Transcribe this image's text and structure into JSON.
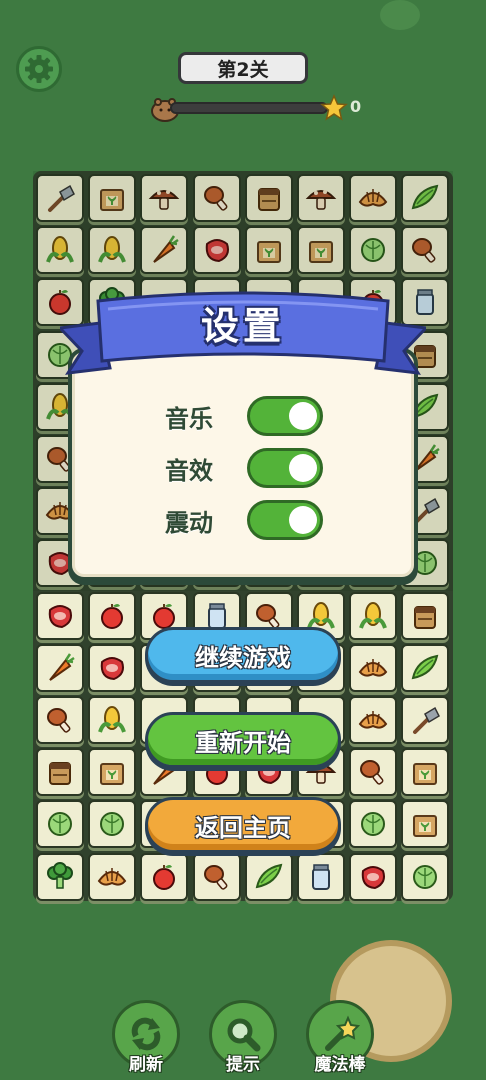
{
  "header": {
    "level_label": "第2关",
    "star_count": "0",
    "progress_fraction": 0.0
  },
  "settings_dialog": {
    "title": "设置",
    "options": [
      {
        "label": "音乐",
        "enabled": true
      },
      {
        "label": "音效",
        "enabled": true
      },
      {
        "label": "震动",
        "enabled": true
      }
    ]
  },
  "menu": {
    "continue_label": "继续游戏",
    "restart_label": "重新开始",
    "home_label": "返回主页"
  },
  "tools": [
    {
      "label": "刷新",
      "icon": "refresh-icon"
    },
    {
      "label": "提示",
      "icon": "magnifier-icon"
    },
    {
      "label": "魔法棒",
      "icon": "magic-wand-icon"
    }
  ],
  "board": [
    [
      "shovel",
      "seedbox",
      "mushroom",
      "drumstick",
      "soilbag",
      "mushroom",
      "croissant",
      "peapod"
    ],
    [
      "corn",
      "corn",
      "carrot",
      "steak",
      "seedbox",
      "seedbox",
      "cabbage",
      "drumstick"
    ],
    [
      "apple",
      "broccoli",
      "",
      "",
      "",
      "",
      "apple",
      "jar"
    ],
    [
      "cabbage",
      "",
      "",
      "",
      "",
      "",
      "",
      "soilbag"
    ],
    [
      "corn",
      "",
      "",
      "",
      "",
      "",
      "",
      "peapod"
    ],
    [
      "drumstick",
      "",
      "",
      "",
      "",
      "",
      "",
      "carrot"
    ],
    [
      "croissant",
      "",
      "",
      "",
      "",
      "",
      "",
      "shovel"
    ],
    [
      "steak",
      "",
      "",
      "",
      "",
      "",
      "",
      "cabbage"
    ],
    [
      "steak",
      "apple",
      "apple",
      "jar",
      "drumstick",
      "corn",
      "corn",
      "soilbag"
    ],
    [
      "carrot",
      "steak",
      "",
      "",
      "",
      "",
      "croissant",
      "peapod"
    ],
    [
      "drumstick",
      "corn",
      "",
      "",
      "",
      "",
      "croissant",
      "shovel"
    ],
    [
      "soilbag",
      "seedbox",
      "carrot",
      "apple",
      "steak",
      "mushroom",
      "drumstick",
      "seedbox"
    ],
    [
      "cabbage",
      "cabbage",
      "",
      "",
      "",
      "",
      "cabbage",
      "seedbox"
    ],
    [
      "broccoli",
      "croissant",
      "apple",
      "drumstick",
      "peapod",
      "jar",
      "steak",
      "cabbage"
    ]
  ],
  "colors": {
    "background": "#3e7a41",
    "ribbon": "#5a6fe0",
    "continue_button": "#4fb8ec",
    "restart_button": "#63c440",
    "home_button": "#f2a93b",
    "toggle_on": "#53b339"
  }
}
